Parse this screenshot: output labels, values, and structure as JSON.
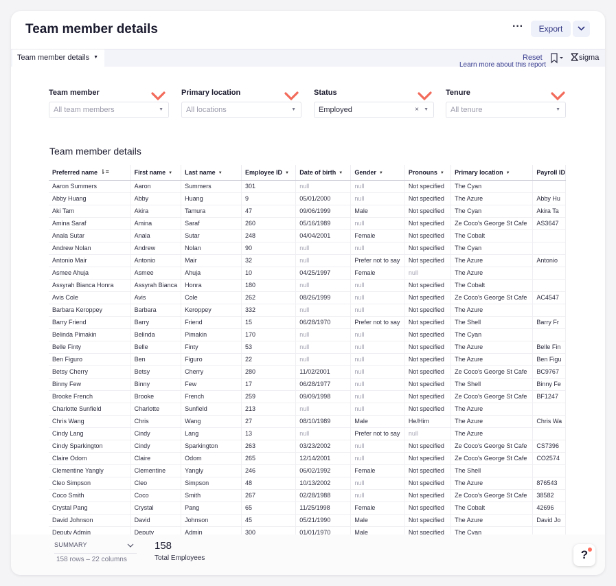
{
  "header": {
    "title": "Team member details",
    "more_label": "···",
    "export_label": "Export"
  },
  "toolbar": {
    "tab_label": "Team member details",
    "reset_label": "Reset",
    "brand": "sigma"
  },
  "learn_more": "Learn more about this report",
  "filters": [
    {
      "label": "Team member",
      "value": "All team members",
      "filled": false
    },
    {
      "label": "Primary location",
      "value": "All locations",
      "filled": false
    },
    {
      "label": "Status",
      "value": "Employed",
      "filled": true
    },
    {
      "label": "Tenure",
      "value": "All tenure",
      "filled": false
    }
  ],
  "accent_colors": {
    "check_mark": "#f26b5b",
    "link": "#3b3f8f",
    "notification_dot": "#ff6b5a"
  },
  "table": {
    "title": "Team member details",
    "columns": [
      "Preferred name",
      "First name",
      "Last name",
      "Employee ID",
      "Date of birth",
      "Gender",
      "Pronouns",
      "Primary location",
      "Payroll ID"
    ],
    "rows": [
      [
        "Aaron Summers",
        "Aaron",
        "Summers",
        "301",
        "null",
        "null",
        "Not specified",
        "The Cyan",
        ""
      ],
      [
        "Abby Huang",
        "Abby",
        "Huang",
        "9",
        "05/01/2000",
        "null",
        "Not specified",
        "The Azure",
        "Abby Hu"
      ],
      [
        "Aki Tam",
        "Akira",
        "Tamura",
        "47",
        "09/06/1999",
        "Male",
        "Not specified",
        "The Cyan",
        "Akira Ta"
      ],
      [
        "Amina Saraf",
        "Amina",
        "Saraf",
        "260",
        "05/16/1989",
        "null",
        "Not specified",
        "Ze Coco's George St Cafe",
        "AS3647"
      ],
      [
        "Anala Sutar",
        "Anala",
        "Sutar",
        "248",
        "04/04/2001",
        "Female",
        "Not specified",
        "The Cobalt",
        ""
      ],
      [
        "Andrew Nolan",
        "Andrew",
        "Nolan",
        "90",
        "null",
        "null",
        "Not specified",
        "The Cyan",
        ""
      ],
      [
        "Antonio Mair",
        "Antonio",
        "Mair",
        "32",
        "null",
        "Prefer not to say",
        "Not specified",
        "The Azure",
        "Antonio"
      ],
      [
        "Asmee Ahuja",
        "Asmee",
        "Ahuja",
        "10",
        "04/25/1997",
        "Female",
        "null",
        "The Azure",
        ""
      ],
      [
        "Assyrah Bianca Honra",
        "Assyrah Bianca",
        "Honra",
        "180",
        "null",
        "null",
        "Not specified",
        "The Cobalt",
        ""
      ],
      [
        "Avis Cole",
        "Avis",
        "Cole",
        "262",
        "08/26/1999",
        "null",
        "Not specified",
        "Ze Coco's George St Cafe",
        "AC4547"
      ],
      [
        "Barbara Keroppey",
        "Barbara",
        "Keroppey",
        "332",
        "null",
        "null",
        "Not specified",
        "The Azure",
        ""
      ],
      [
        "Barry Friend",
        "Barry",
        "Friend",
        "15",
        "06/28/1970",
        "Prefer not to say",
        "Not specified",
        "The Shell",
        "Barry Fr"
      ],
      [
        "Belinda Pimakin",
        "Belinda",
        "Pimakin",
        "170",
        "null",
        "null",
        "Not specified",
        "The Cyan",
        ""
      ],
      [
        "Belle Finty",
        "Belle",
        "Finty",
        "53",
        "null",
        "null",
        "Not specified",
        "The Azure",
        "Belle Fin"
      ],
      [
        "Ben Figuro",
        "Ben",
        "Figuro",
        "22",
        "null",
        "null",
        "Not specified",
        "The Azure",
        "Ben Figu"
      ],
      [
        "Betsy Cherry",
        "Betsy",
        "Cherry",
        "280",
        "11/02/2001",
        "null",
        "Not specified",
        "Ze Coco's George St Cafe",
        "BC9767"
      ],
      [
        "Binny Few",
        "Binny",
        "Few",
        "17",
        "06/28/1977",
        "null",
        "Not specified",
        "The Shell",
        "Binny Fe"
      ],
      [
        "Brooke French",
        "Brooke",
        "French",
        "259",
        "09/09/1998",
        "null",
        "Not specified",
        "Ze Coco's George St Cafe",
        "BF1247"
      ],
      [
        "Charlotte Sunfield",
        "Charlotte",
        "Sunfield",
        "213",
        "null",
        "null",
        "Not specified",
        "The Azure",
        ""
      ],
      [
        "Chris Wang",
        "Chris",
        "Wang",
        "27",
        "08/10/1989",
        "Male",
        "He/Him",
        "The Azure",
        "Chris Wa"
      ],
      [
        "Cindy Lang",
        "Cindy",
        "Lang",
        "13",
        "null",
        "Prefer not to say",
        "null",
        "The Azure",
        ""
      ],
      [
        "Cindy Sparkington",
        "Cindy",
        "Sparkington",
        "263",
        "03/23/2002",
        "null",
        "Not specified",
        "Ze Coco's George St Cafe",
        "CS7396"
      ],
      [
        "Claire Odom",
        "Claire",
        "Odom",
        "265",
        "12/14/2001",
        "null",
        "Not specified",
        "Ze Coco's George St Cafe",
        "CO2574"
      ],
      [
        "Clementine Yangly",
        "Clementine",
        "Yangly",
        "246",
        "06/02/1992",
        "Female",
        "Not specified",
        "The Shell",
        ""
      ],
      [
        "Cleo Simpson",
        "Cleo",
        "Simpson",
        "48",
        "10/13/2002",
        "null",
        "Not specified",
        "The Azure",
        "876543"
      ],
      [
        "Coco Smith",
        "Coco",
        "Smith",
        "267",
        "02/28/1988",
        "null",
        "Not specified",
        "Ze Coco's George St Cafe",
        "38582"
      ],
      [
        "Crystal Pang",
        "Crystal",
        "Pang",
        "65",
        "11/25/1998",
        "Female",
        "Not specified",
        "The Cobalt",
        "42696"
      ],
      [
        "David Johnson",
        "David",
        "Johnson",
        "45",
        "05/21/1990",
        "Male",
        "Not specified",
        "The Azure",
        "David Jo"
      ],
      [
        "Deputy Admin",
        "Deputy",
        "Admin",
        "300",
        "01/01/1970",
        "Male",
        "Not specified",
        "The Cyan",
        ""
      ]
    ]
  },
  "summary": {
    "toggle_label": "SUMMARY",
    "meta": "158 rows – 22 columns",
    "value": "158",
    "label": "Total Employees"
  },
  "help": {
    "label": "?"
  }
}
